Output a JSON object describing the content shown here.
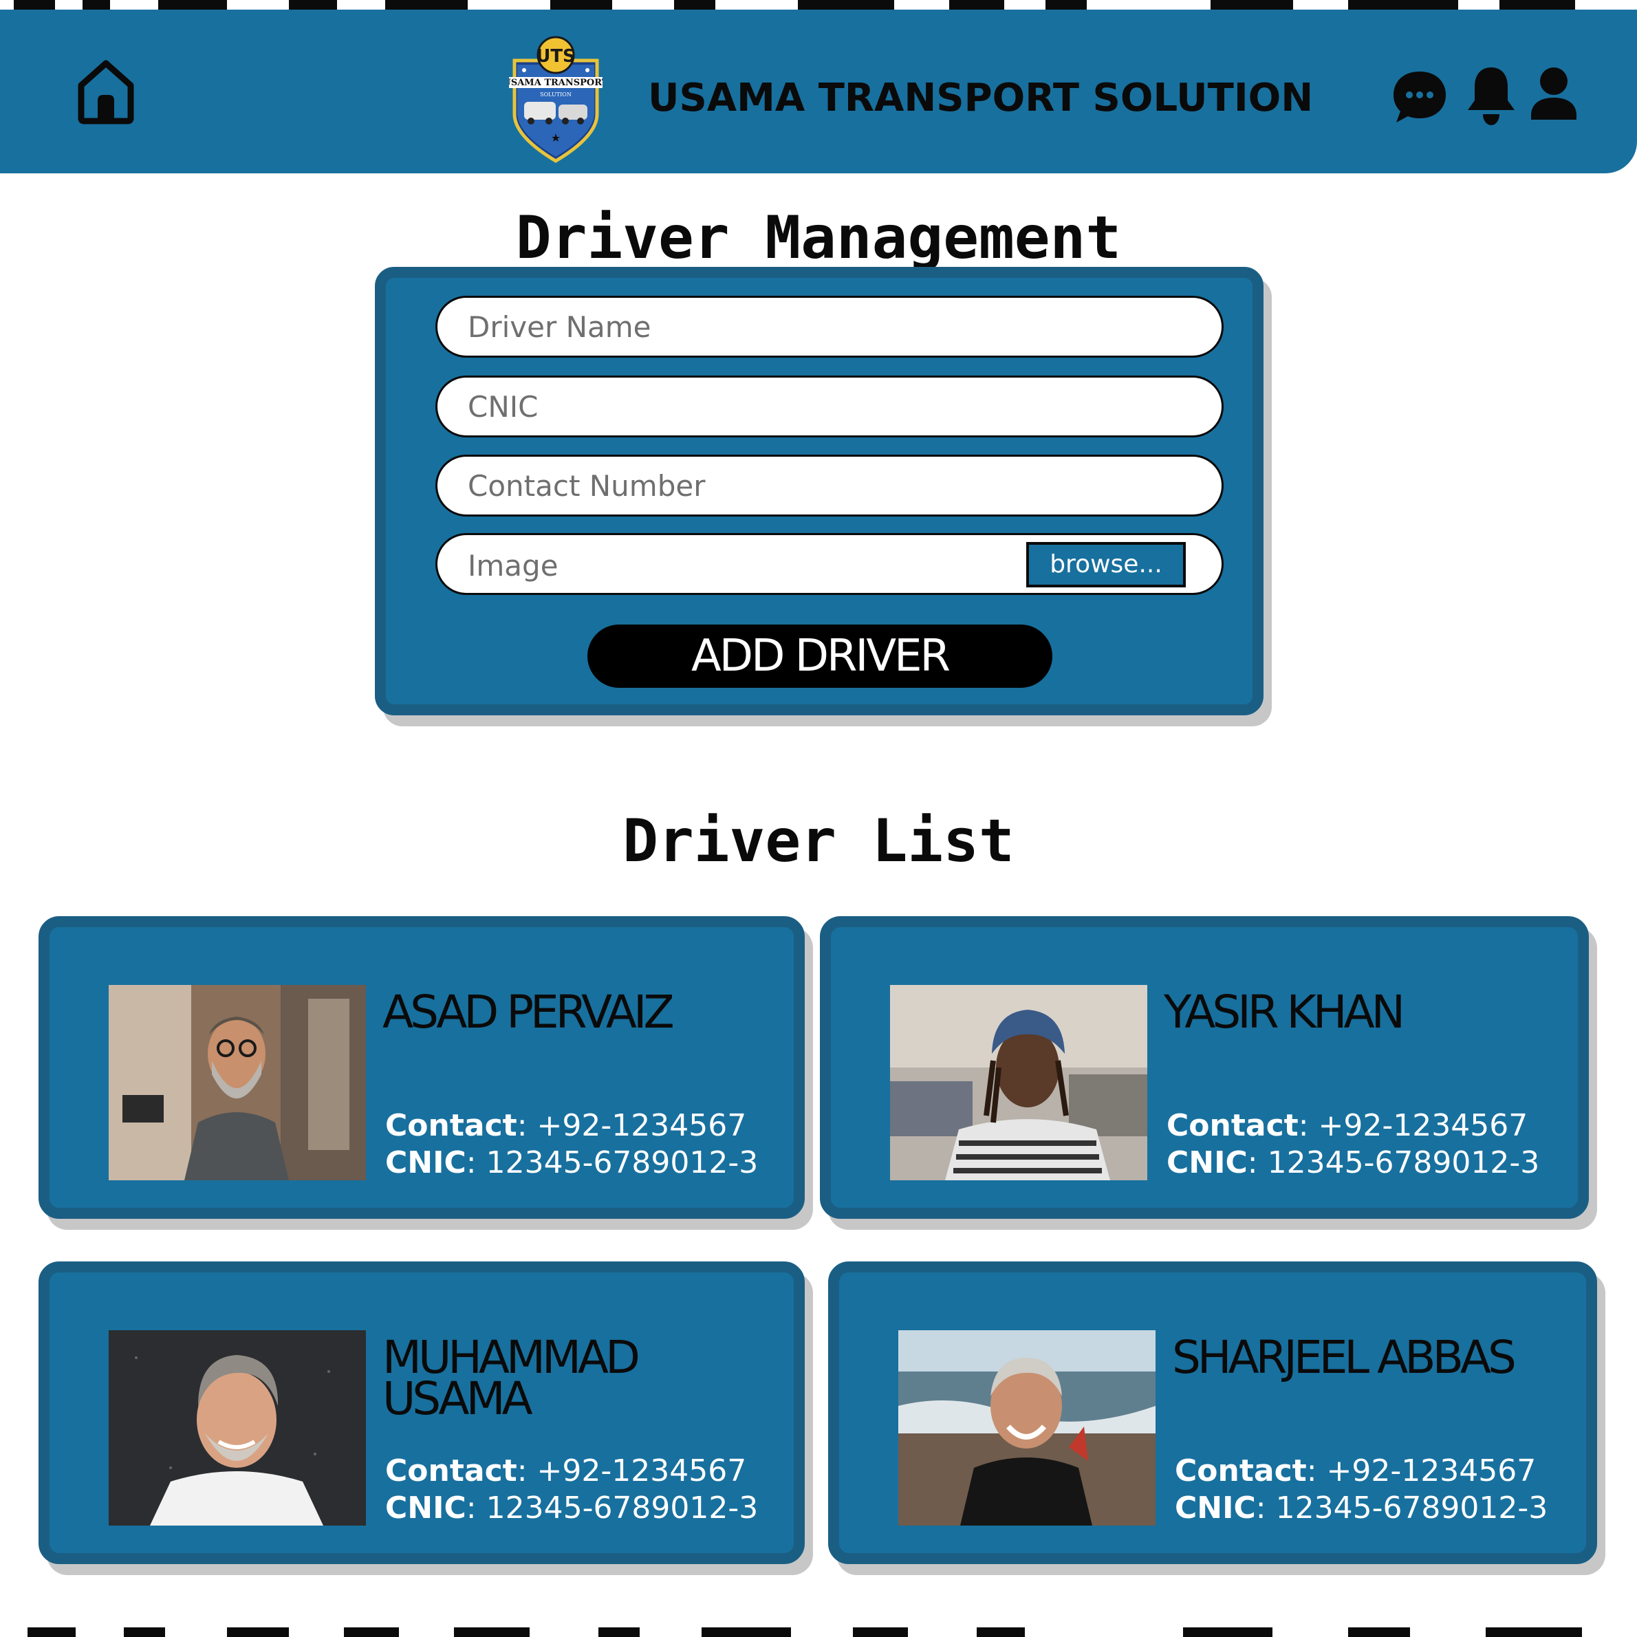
{
  "header": {
    "brand_title": "USAMA TRANSPORT SOLUTION",
    "logo": {
      "monogram": "UTS",
      "banner": "USAMA TRANSPORT",
      "sub": "SOLUTION"
    }
  },
  "management": {
    "title": "Driver Management",
    "form": {
      "driver_name_placeholder": "Driver Name",
      "cnic_placeholder": "CNIC",
      "contact_placeholder": "Contact Number",
      "image_label": "Image",
      "browse_label": "browse...",
      "submit_label": "ADD DRIVER"
    }
  },
  "driver_list": {
    "title": "Driver List",
    "contact_label": "Contact",
    "cnic_label": "CNIC",
    "drivers": [
      {
        "name": "ASAD PERVAIZ",
        "contact": "+92-1234567",
        "cnic": "12345-6789012-3"
      },
      {
        "name": "YASIR KHAN",
        "contact": "+92-1234567",
        "cnic": "12345-6789012-3"
      },
      {
        "name": "MUHAMMAD USAMA",
        "contact": "+92-1234567",
        "cnic": "12345-6789012-3"
      },
      {
        "name": "SHARJEEL ABBAS",
        "contact": "+92-1234567",
        "cnic": "12345-6789012-3"
      }
    ]
  },
  "colors": {
    "primary": "#18709e",
    "panel_border": "#1b5e84",
    "text_dark": "#0a0a0a",
    "shadow": "#c7c7c7"
  }
}
